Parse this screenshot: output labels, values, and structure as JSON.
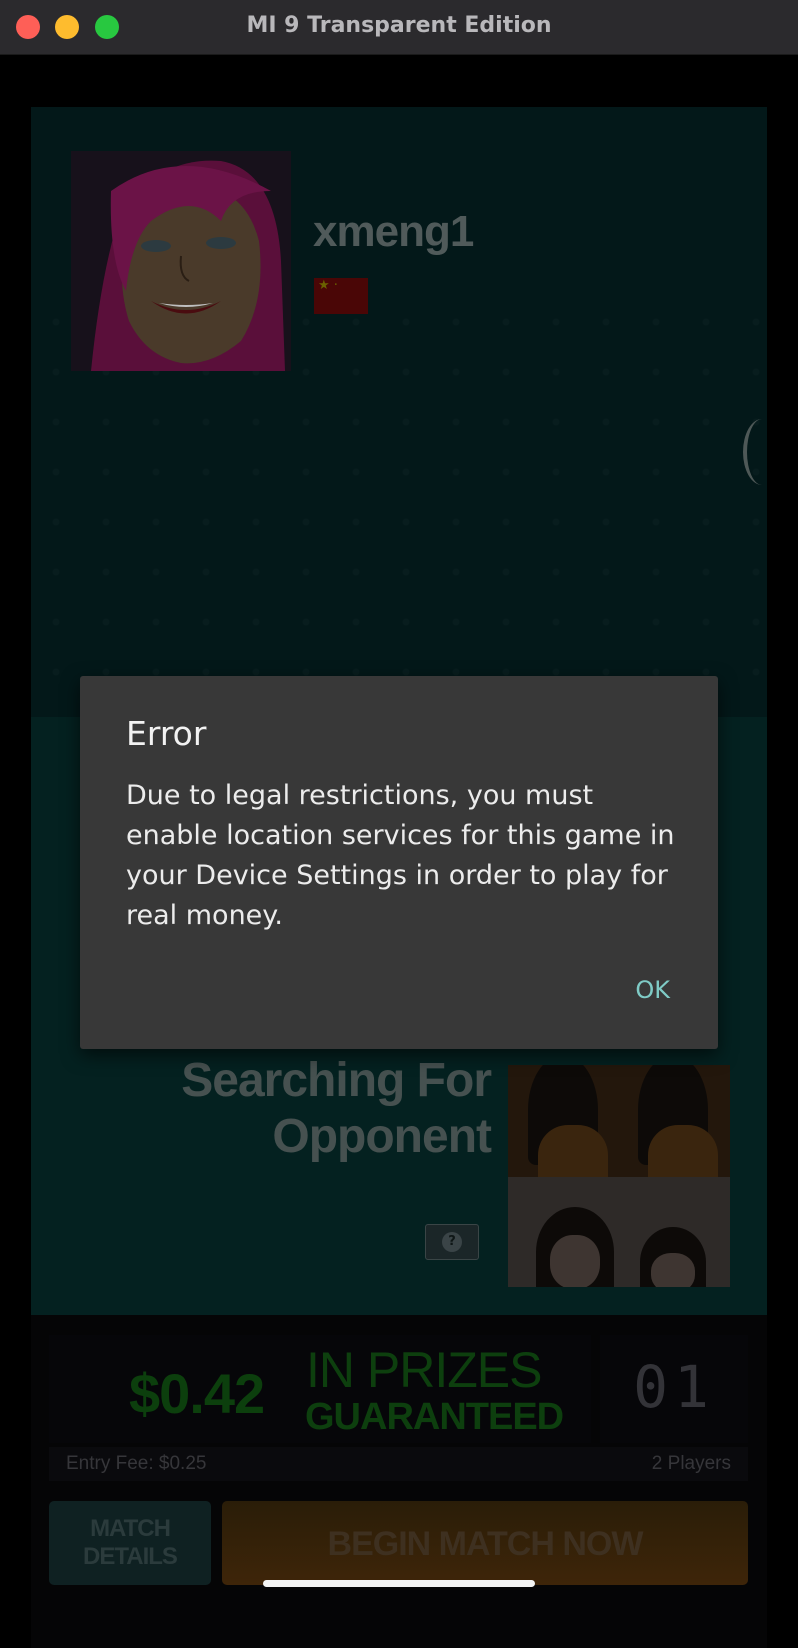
{
  "window": {
    "title": "MI 9 Transparent Edition"
  },
  "player": {
    "username": "xmeng1",
    "flag": "china-flag"
  },
  "matchmaking": {
    "status_line1": "Searching For",
    "status_line2": "Opponent",
    "help_label": "?"
  },
  "prize": {
    "amount": "$0.42",
    "label_top": "IN PRIZES",
    "label_bottom": "GUARANTEED",
    "counter": "01",
    "entry_fee": "Entry Fee: $0.25",
    "players": "2 Players"
  },
  "actions": {
    "match_details_line1": "MATCH",
    "match_details_line2": "DETAILS",
    "begin_match": "BEGIN MATCH NOW"
  },
  "dialog": {
    "title": "Error",
    "message": "Due to legal restrictions, you must enable location services for this game in your Device Settings in order to play for real money.",
    "ok_label": "OK"
  },
  "colors": {
    "accent": "#7fcbc6",
    "dialog_bg": "#383838",
    "prize_green": "#0d3f0e"
  }
}
